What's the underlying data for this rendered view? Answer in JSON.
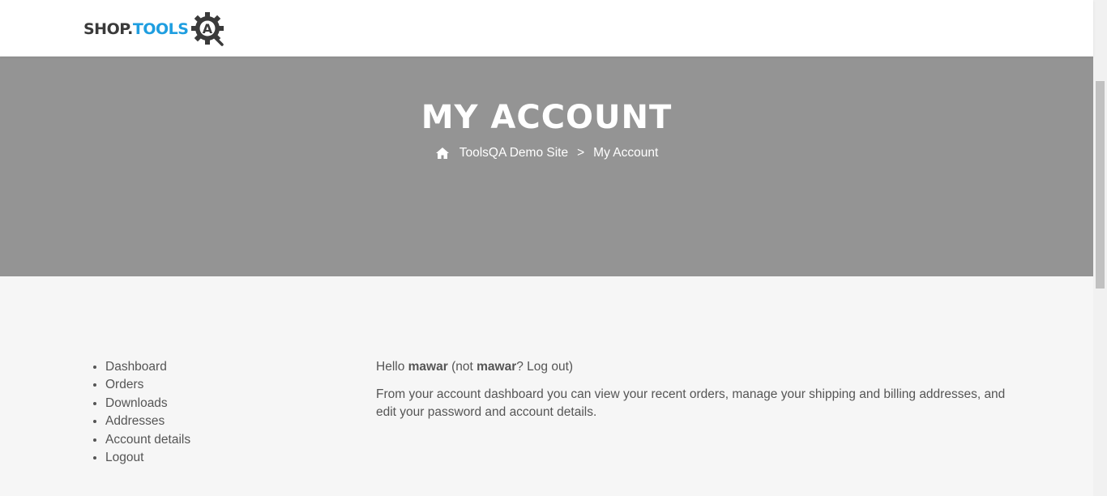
{
  "header": {
    "logo": {
      "part1": "SHOP.",
      "part2": "TOOLS",
      "badge": "A"
    }
  },
  "hero": {
    "title": "MY ACCOUNT",
    "breadcrumb": {
      "home_icon": "home-icon",
      "site": "ToolsQA Demo Site",
      "separator": ">",
      "current": "My Account"
    }
  },
  "account_nav": {
    "items": [
      {
        "label": "Dashboard"
      },
      {
        "label": "Orders"
      },
      {
        "label": "Downloads"
      },
      {
        "label": "Addresses"
      },
      {
        "label": "Account details"
      },
      {
        "label": "Logout"
      }
    ]
  },
  "dashboard": {
    "hello": "Hello",
    "username": "mawar",
    "not_prefix": "(not",
    "username_again": "mawar",
    "question": "?",
    "logout_link": "Log out",
    "close_paren": ")",
    "description": "From your account dashboard you can view your recent orders, manage your shipping and billing addresses, and edit your password and account details."
  },
  "colors": {
    "hero_bg": "#949494",
    "content_bg": "#f6f6f6",
    "text": "#555555",
    "logo_accent": "#1f9ee0"
  }
}
